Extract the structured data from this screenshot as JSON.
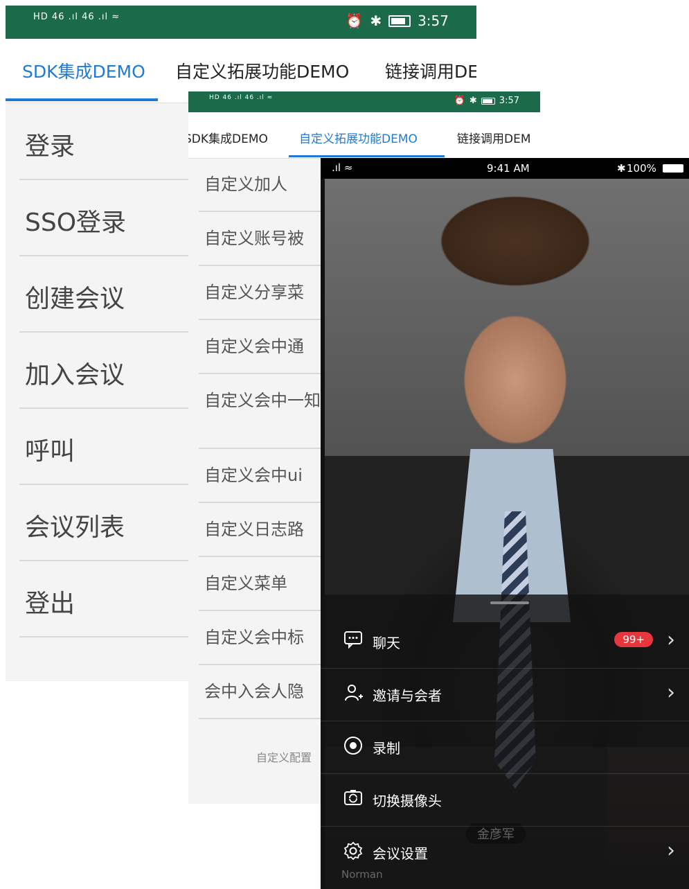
{
  "screen1": {
    "status": {
      "left": "HD 46 .ıl 46 .ıl ≈",
      "time": "3:57"
    },
    "tabs": [
      "SDK集成DEMO",
      "自定义拓展功能DEMO",
      "链接调用DE"
    ],
    "active_tab": 0,
    "menu": [
      "登录",
      "SSO登录",
      "创建会议",
      "加入会议",
      "呼叫",
      "会议列表",
      "登出"
    ]
  },
  "screen2": {
    "status": {
      "left": "HD 46 .ıl 46 .ıl ≈",
      "time": "3:57"
    },
    "tabs": [
      "SDK集成DEMO",
      "自定义拓展功能DEMO",
      "链接调用DEM"
    ],
    "active_tab": 1,
    "menu": [
      "自定义加人",
      "自定义账号被",
      "自定义分享菜",
      "自定义会中通",
      "自定义会中一知",
      "自定义会中ui",
      "自定义日志路",
      "自定义菜单",
      "自定义会中标",
      "会中入会人隐"
    ],
    "footer": "自定义配置"
  },
  "screen3": {
    "status": {
      "signal": ".ıl ≈",
      "time": "9:41 AM",
      "battery": "100%"
    },
    "menu": [
      {
        "icon": "chat-icon",
        "label": "聊天",
        "badge": "99+",
        "chevron": true
      },
      {
        "icon": "invite-person-icon",
        "label": "邀请与会者",
        "chevron": true
      },
      {
        "icon": "record-icon",
        "label": "录制",
        "chevron": false
      },
      {
        "icon": "switch-camera-icon",
        "label": "切换摄像头",
        "chevron": false
      },
      {
        "icon": "settings-gear-icon",
        "label": "会议设置",
        "chevron": true
      }
    ],
    "speaker_name": "金彦军",
    "participant_name": "Norman"
  },
  "colors": {
    "accent": "#1e7ad6",
    "statusbar": "#1b6b4a",
    "badge": "#e7373c"
  }
}
